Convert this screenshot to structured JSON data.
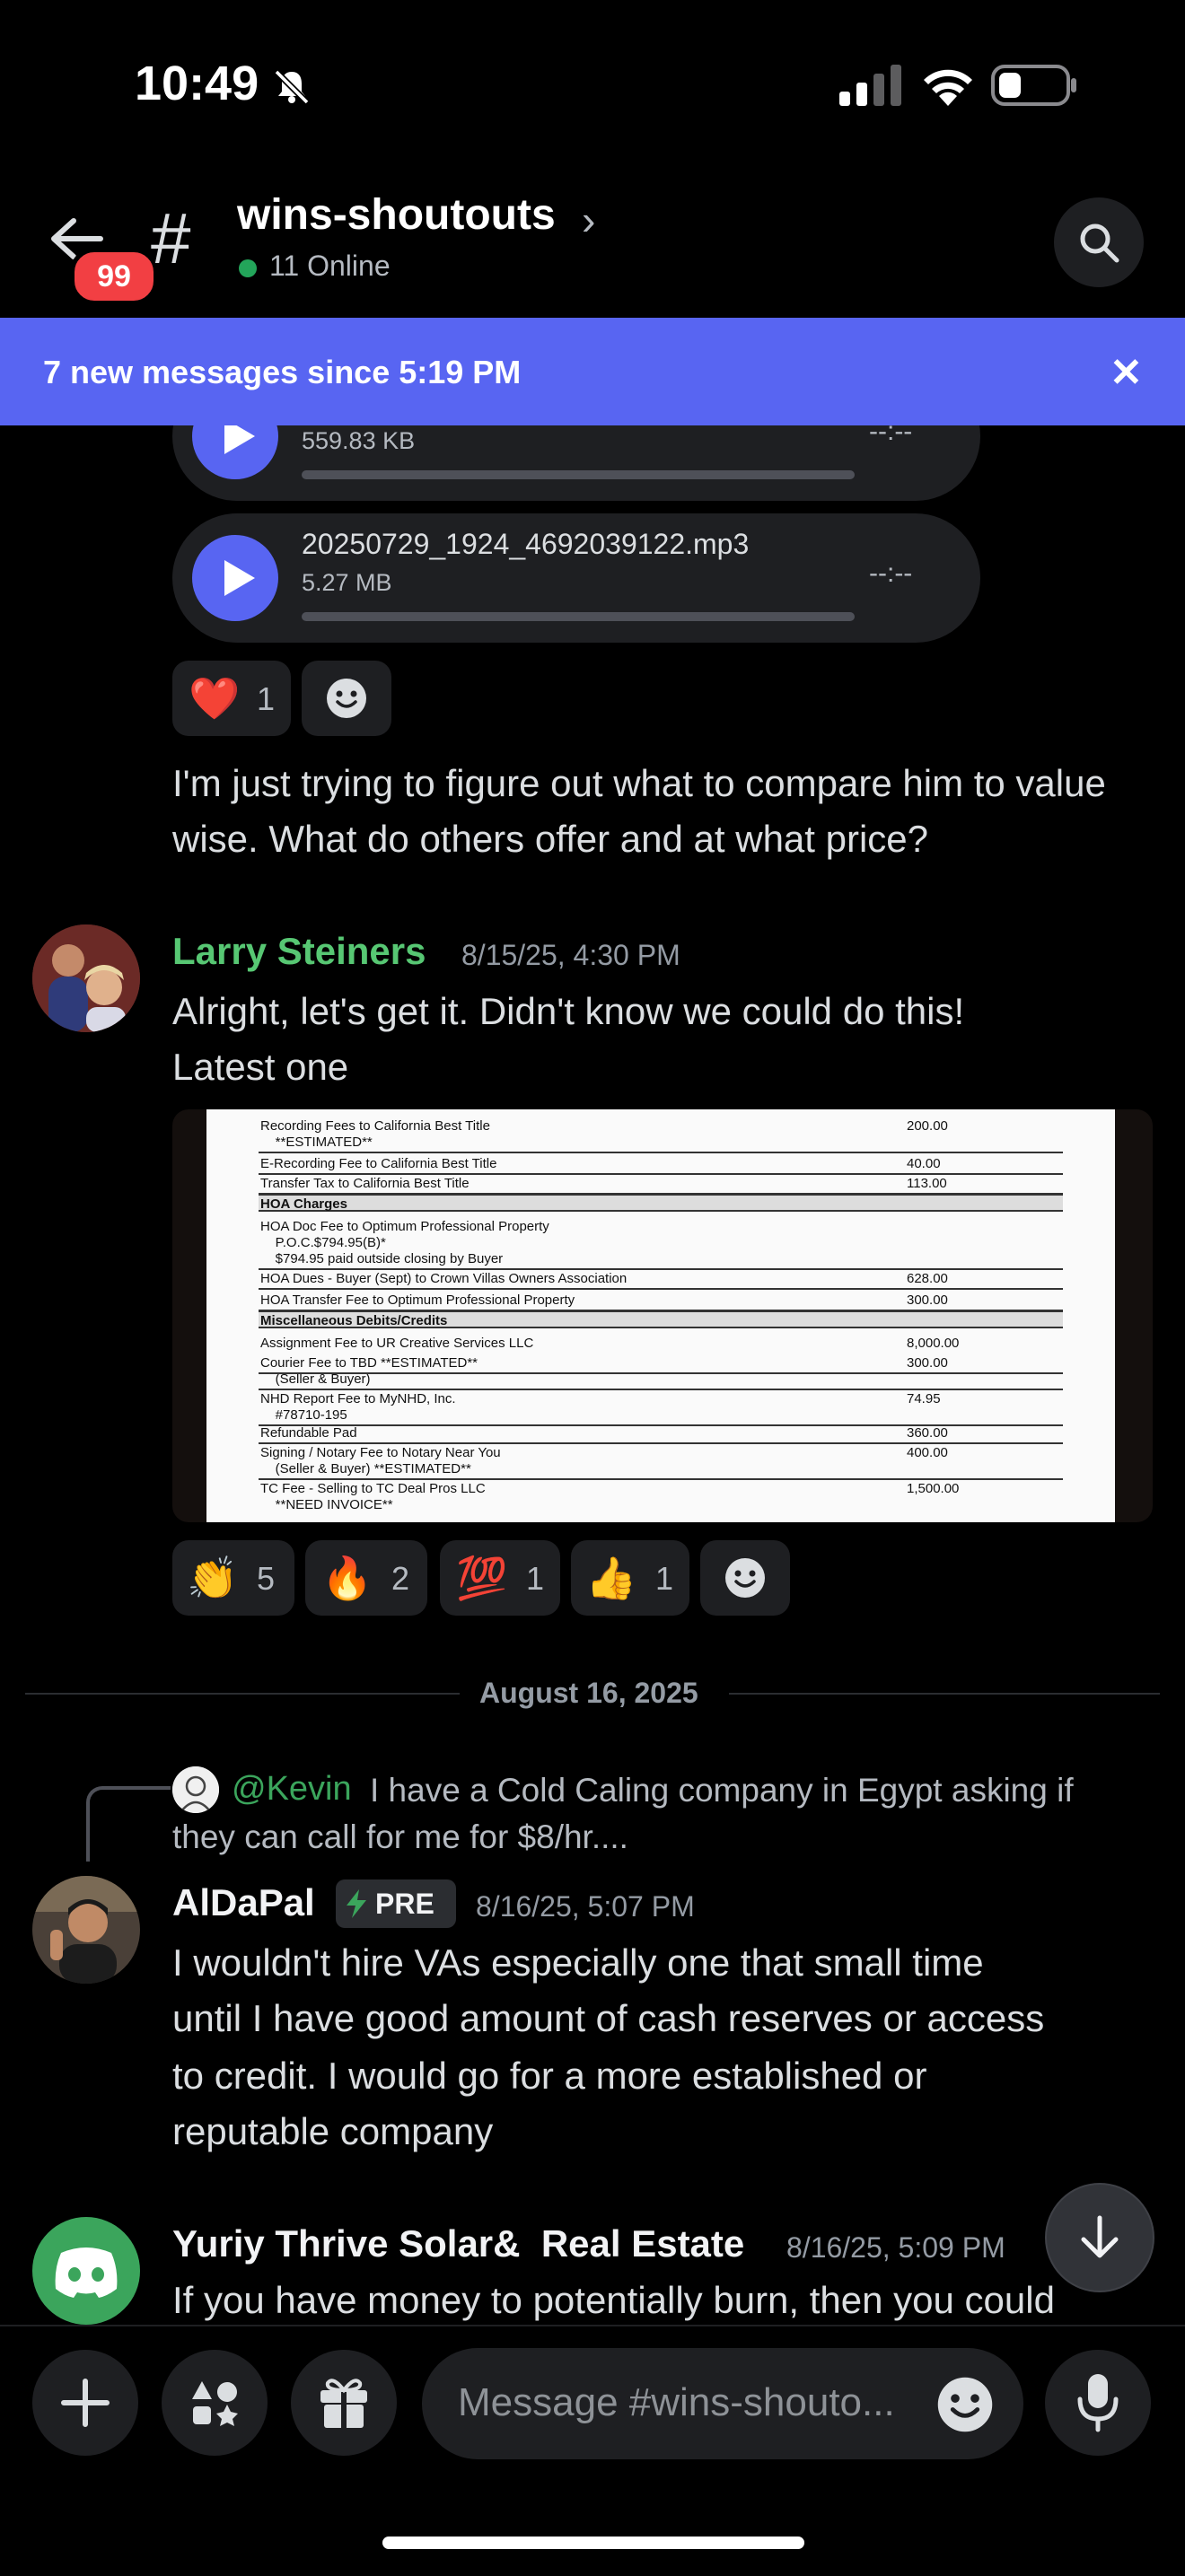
{
  "status_bar": {
    "time": "10:49"
  },
  "header": {
    "badge": "99",
    "channel_name": "wins-shoutouts",
    "online": "11 Online"
  },
  "banner": {
    "text": "7 new messages since 5:19 PM"
  },
  "audio_files": [
    {
      "name": "",
      "size": "559.83 KB",
      "time": "--:--"
    },
    {
      "name": "20250729_1924_4692039122.mp3",
      "size": "5.27 MB",
      "time": "--:--"
    }
  ],
  "reactions_1": [
    {
      "emoji": "❤️",
      "count": "1"
    }
  ],
  "message_1_text": "I'm just trying to figure out what to compare him to value wise.  What do others offer and at what price?",
  "message_2": {
    "author": "Larry Steiners",
    "author_color": "#57c773",
    "timestamp": "8/15/25, 4:30 PM",
    "lines": [
      "Alright, let's get it. Didn't know we could do this!",
      "Latest one"
    ]
  },
  "document": {
    "rows": [
      {
        "label": "Recording Fees to California Best Title",
        "amount": "200.00"
      },
      {
        "label": "    **ESTIMATED**",
        "amount": ""
      },
      {
        "label": "E-Recording Fee to California Best Title",
        "amount": "40.00"
      },
      {
        "label": "Transfer Tax to California Best Title",
        "amount": "113.00"
      },
      {
        "label": "HOA Charges",
        "amount": ""
      },
      {
        "label": "HOA Doc Fee to Optimum Professional Property",
        "amount": ""
      },
      {
        "label": "    P.O.C.$794.95(B)*",
        "amount": ""
      },
      {
        "label": "    $794.95 paid outside closing by Buyer",
        "amount": ""
      },
      {
        "label": "HOA Dues - Buyer (Sept) to Crown Villas Owners Association",
        "amount": "628.00"
      },
      {
        "label": "HOA Transfer Fee to Optimum Professional Property",
        "amount": "300.00"
      },
      {
        "label": "Miscellaneous Debits/Credits",
        "amount": ""
      },
      {
        "label": "Assignment Fee to UR Creative Services LLC",
        "amount": "8,000.00"
      },
      {
        "label": "Courier Fee to TBD **ESTIMATED**",
        "amount": "300.00"
      },
      {
        "label": "    (Seller & Buyer)",
        "amount": ""
      },
      {
        "label": "NHD Report Fee to MyNHD, Inc.",
        "amount": "74.95"
      },
      {
        "label": "    #78710-195",
        "amount": ""
      },
      {
        "label": "Refundable Pad",
        "amount": "360.00"
      },
      {
        "label": "Signing / Notary Fee to Notary Near You",
        "amount": "400.00"
      },
      {
        "label": "    (Seller & Buyer) **ESTIMATED**",
        "amount": ""
      },
      {
        "label": "TC Fee - Selling to TC Deal Pros LLC",
        "amount": "1,500.00"
      },
      {
        "label": "    **NEED INVOICE**",
        "amount": ""
      }
    ]
  },
  "reactions_2": [
    {
      "emoji": "👏",
      "count": "5"
    },
    {
      "emoji": "🔥",
      "count": "2"
    },
    {
      "emoji": "💯",
      "count": "1"
    },
    {
      "emoji": "👍",
      "count": "1"
    }
  ],
  "date_divider": "August 16, 2025",
  "reply": {
    "mention": "@Kevin",
    "text": "I have a Cold Caling company in Egypt asking if",
    "text_2": "they can call for me for $8/hr...."
  },
  "message_3": {
    "author": "AlDaPal",
    "tag": "PRE",
    "timestamp": "8/16/25, 5:07 PM",
    "lines": [
      "I wouldn't hire VAs especially one that small time",
      "until I have good amount of cash reserves or access",
      "to credit. I would go for a more established or",
      "reputable company"
    ]
  },
  "message_4": {
    "author": "Yuriy Thrive Solar&  Real Estate",
    "timestamp": "8/16/25, 5:09 PM",
    "line": "If you have money to potentially burn, then you could"
  },
  "composer": {
    "placeholder": "Message #wins-shouto..."
  },
  "colors": {
    "accent": "#5865f2",
    "online": "#23a55a",
    "badge": "#f23f43"
  }
}
